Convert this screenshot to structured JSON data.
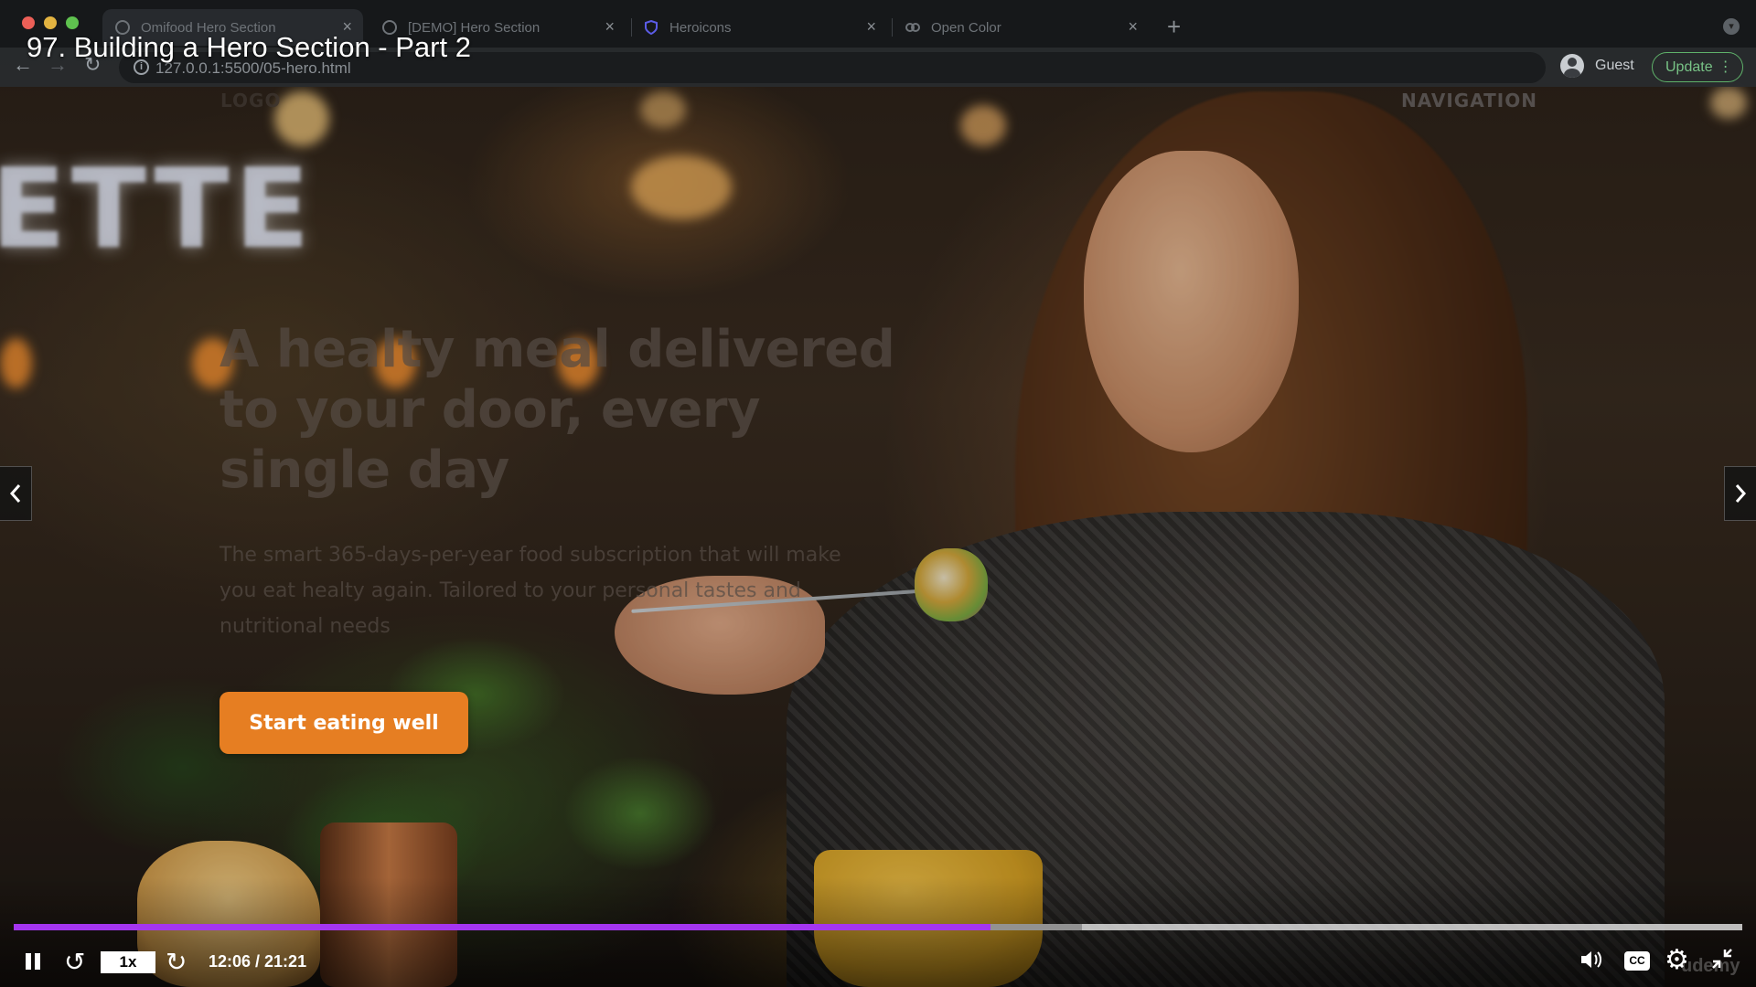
{
  "browser": {
    "tabs": [
      {
        "label": "Omifood Hero Section",
        "active": true
      },
      {
        "label": "[DEMO] Hero Section",
        "active": false
      },
      {
        "label": "Heroicons",
        "active": false
      },
      {
        "label": "Open Color",
        "active": false
      }
    ],
    "url": "127.0.0.1:5500/05-hero.html",
    "profile_label": "Guest",
    "update_label": "Update"
  },
  "lecture": {
    "title": "97. Building a Hero Section - Part 2"
  },
  "hero": {
    "logo_label": "LOGO",
    "nav_label": "NAVIGATION",
    "heading": "A healty meal delivered to your door, every single day",
    "description": "The smart 365-days-per-year food subscription that will make you eat healty again. Tailored to your personal tastes and nutritional needs",
    "cta_label": "Start eating well"
  },
  "player": {
    "speed_label": "1x",
    "time_display": "12:06 / 21:21",
    "cc_label": "CC",
    "progress_played_fraction": 0.565,
    "progress_buffered_fraction": 0.618,
    "watermark": "udemy"
  },
  "colors": {
    "progress_played": "#a435f0",
    "cta_background": "#e67e22",
    "update_accent": "#78c386"
  },
  "icons": {
    "nav_prev": "chevron-left-icon",
    "nav_next": "chevron-right-icon",
    "pause": "pause-icon",
    "rewind": "rewind-5-icon",
    "forward": "forward-5-icon",
    "volume": "volume-icon",
    "settings": "gear-icon",
    "fullscreen": "exit-fullscreen-icon"
  }
}
